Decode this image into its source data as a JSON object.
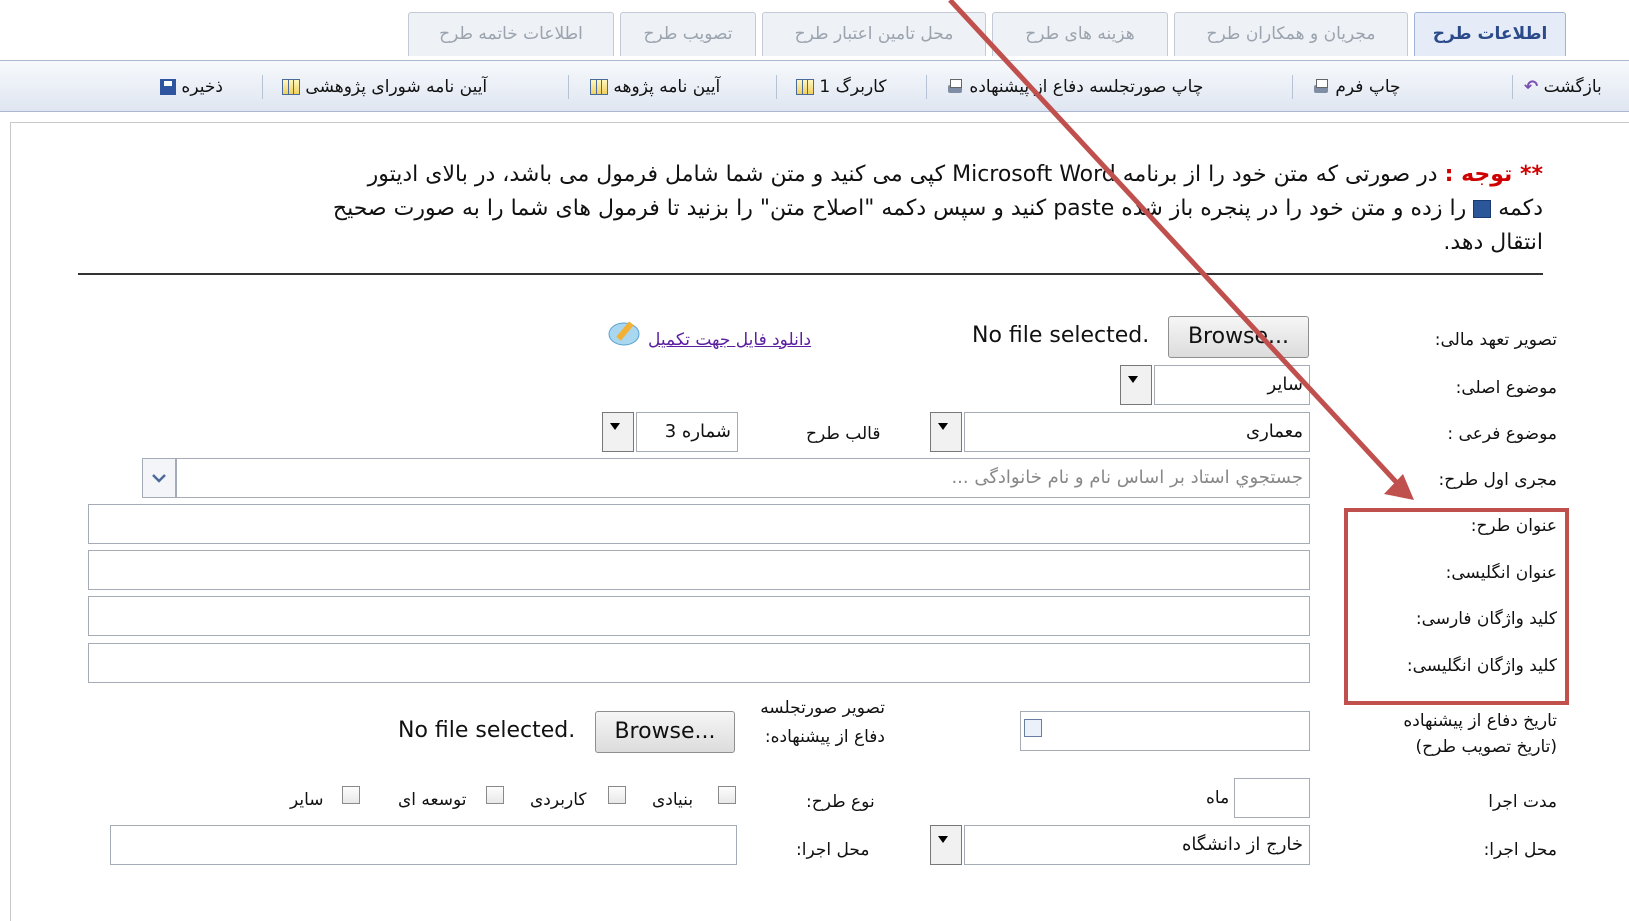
{
  "tabs": [
    {
      "label": "اطلاعات طرح",
      "active": true
    },
    {
      "label": "مجریان و همکاران طرح",
      "active": false
    },
    {
      "label": "هزینه های طرح",
      "active": false
    },
    {
      "label": "محل تامین اعتبار طرح",
      "active": false
    },
    {
      "label": "تصویب طرح",
      "active": false
    },
    {
      "label": "اطلاعات خاتمه طرح",
      "active": false
    }
  ],
  "toolbar": {
    "back": "بازگشت",
    "print_form": "چاپ فرم",
    "print_minutes": "چاپ صورتجلسه دفاع از پیشنهاده",
    "karbarg": "کاربرگ 1",
    "research_regulation": "آیین نامه پژوهه",
    "council_regulation": "آیین نامه شورای پژوهشی",
    "save": "ذخیره"
  },
  "notice": {
    "prefix": "** توجه :",
    "text_line1": "در صورتی که متن خود را از برنامه Microsoft Word کپی می کنید و متن شما شامل فرمول می باشد، در بالای ادیتور",
    "text_line2": "دکمه",
    "text_line2b": "را زده و متن خود را در پنجره باز شده paste کنید و سپس دکمه \"اصلاح متن\" را بزنید تا فرمول های شما را به صورت صحیح",
    "text_line3": "انتقال دهد."
  },
  "form": {
    "financial_label": "تصویر تعهد مالی:",
    "browse_label": "Browse...",
    "no_file": "No file selected.",
    "download_link": "دانلود فایل جهت تکمیل",
    "main_topic_label": "موضوع اصلی:",
    "main_topic_value": "سایر",
    "sub_topic_label": "موضوع فرعی :",
    "sub_topic_value": "معماری",
    "template_label": "قالب طرح",
    "template_value": "شماره 3",
    "first_executor_label": "مجری اول طرح:",
    "first_executor_placeholder": "جستجوي استاد بر اساس نام و نام خانوادگی ...",
    "title_label": "عنوان طرح:",
    "english_title_label": "عنوان انگلیسی:",
    "fa_keywords_label": "کلید واژگان فارسی:",
    "en_keywords_label": "کلید واژگان انگلیسی:",
    "defense_date_label": "تاریخ دفاع از پیشنهاده (تاریخ تصویب طرح)",
    "minutes_image_label": "تصویر صورتجلسه دفاع از پیشنهاده:",
    "duration_label": "مدت اجرا",
    "duration_unit": "ماه",
    "type_label": "نوع طرح:",
    "types": [
      "بنیادی",
      "کاربردی",
      "توسعه ای",
      "سایر"
    ],
    "location_label": "محل اجرا:",
    "location_value": "خارج از دانشگاه",
    "location_label2": "محل اجرا:"
  }
}
